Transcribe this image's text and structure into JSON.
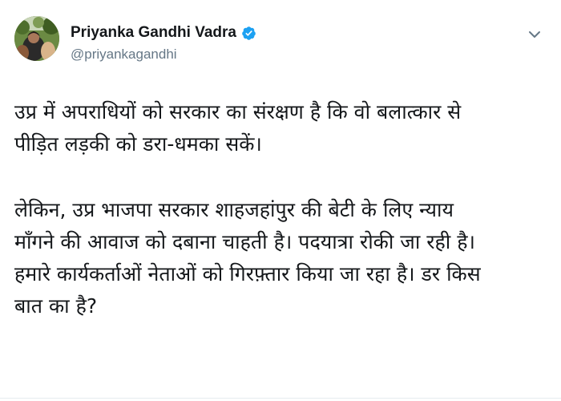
{
  "author": {
    "display_name": "Priyanka Gandhi Vadra",
    "handle": "@priyankagandhi",
    "verified": true
  },
  "icons": {
    "verified": "verified-badge-icon",
    "menu": "chevron-down-icon"
  },
  "colors": {
    "verified_blue": "#1da1f2",
    "handle_gray": "#657786",
    "text": "#14171a"
  },
  "tweet": {
    "paragraphs": [
      {
        "lines": [
          "उप्र में अपराधियों को सरकार का संरक्षण है कि वो बलात्कार से",
          "पीड़ित लड़की को डरा-धमका सकें।"
        ]
      },
      {
        "lines": [
          "लेकिन, उप्र भाजपा सरकार शाहजहांपुर की बेटी के लिए न्याय",
          "माँगने की आवाज को दबाना चाहती है। पदयात्रा रोकी जा रही है।",
          "हमारे कार्यकर्ताओं नेताओं को गिरफ़्तार किया जा रहा है। डर किस",
          "बात का है?"
        ]
      }
    ]
  }
}
